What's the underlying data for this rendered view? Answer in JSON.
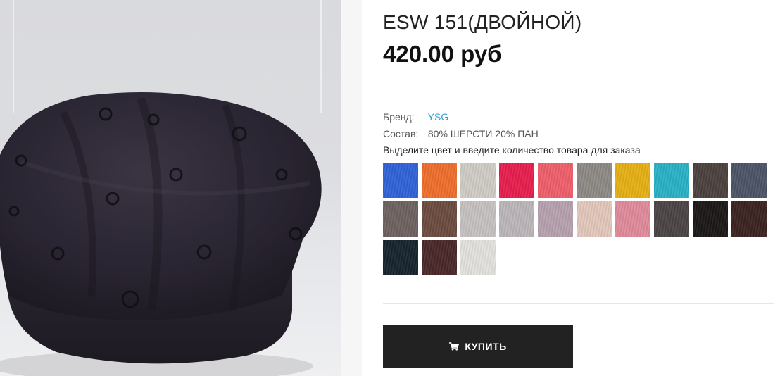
{
  "product": {
    "title": "ESW 151(ДВОЙНОЙ)",
    "price": "420.00 руб"
  },
  "details": {
    "brand_label": "Бренд:",
    "brand_value": "YSG",
    "composition_label": "Состав:",
    "composition_value": "80% ШЕРСТИ 20% ПАН"
  },
  "color_hint": "Выделите цвет и введите количество товара для заказа",
  "swatches": [
    "#2f63d8",
    "#ee6e2c",
    "#cfccc5",
    "#e81e4e",
    "#ee5f6a",
    "#8d8985",
    "#e5b013",
    "#2ab1c6",
    "#4b413e",
    "#4b5466",
    "#6d625f",
    "#6b4b3f",
    "#c6c1c0",
    "#bcb6ba",
    "#b7a2ae",
    "#e3c7bb",
    "#df8a99",
    "#4b4444",
    "#1b1717",
    "#3a2220",
    "#16232e",
    "#4a2729",
    "#e3e1de"
  ],
  "buy_button": {
    "label": "КУПИТЬ",
    "icon": "shopping-cart-icon"
  }
}
